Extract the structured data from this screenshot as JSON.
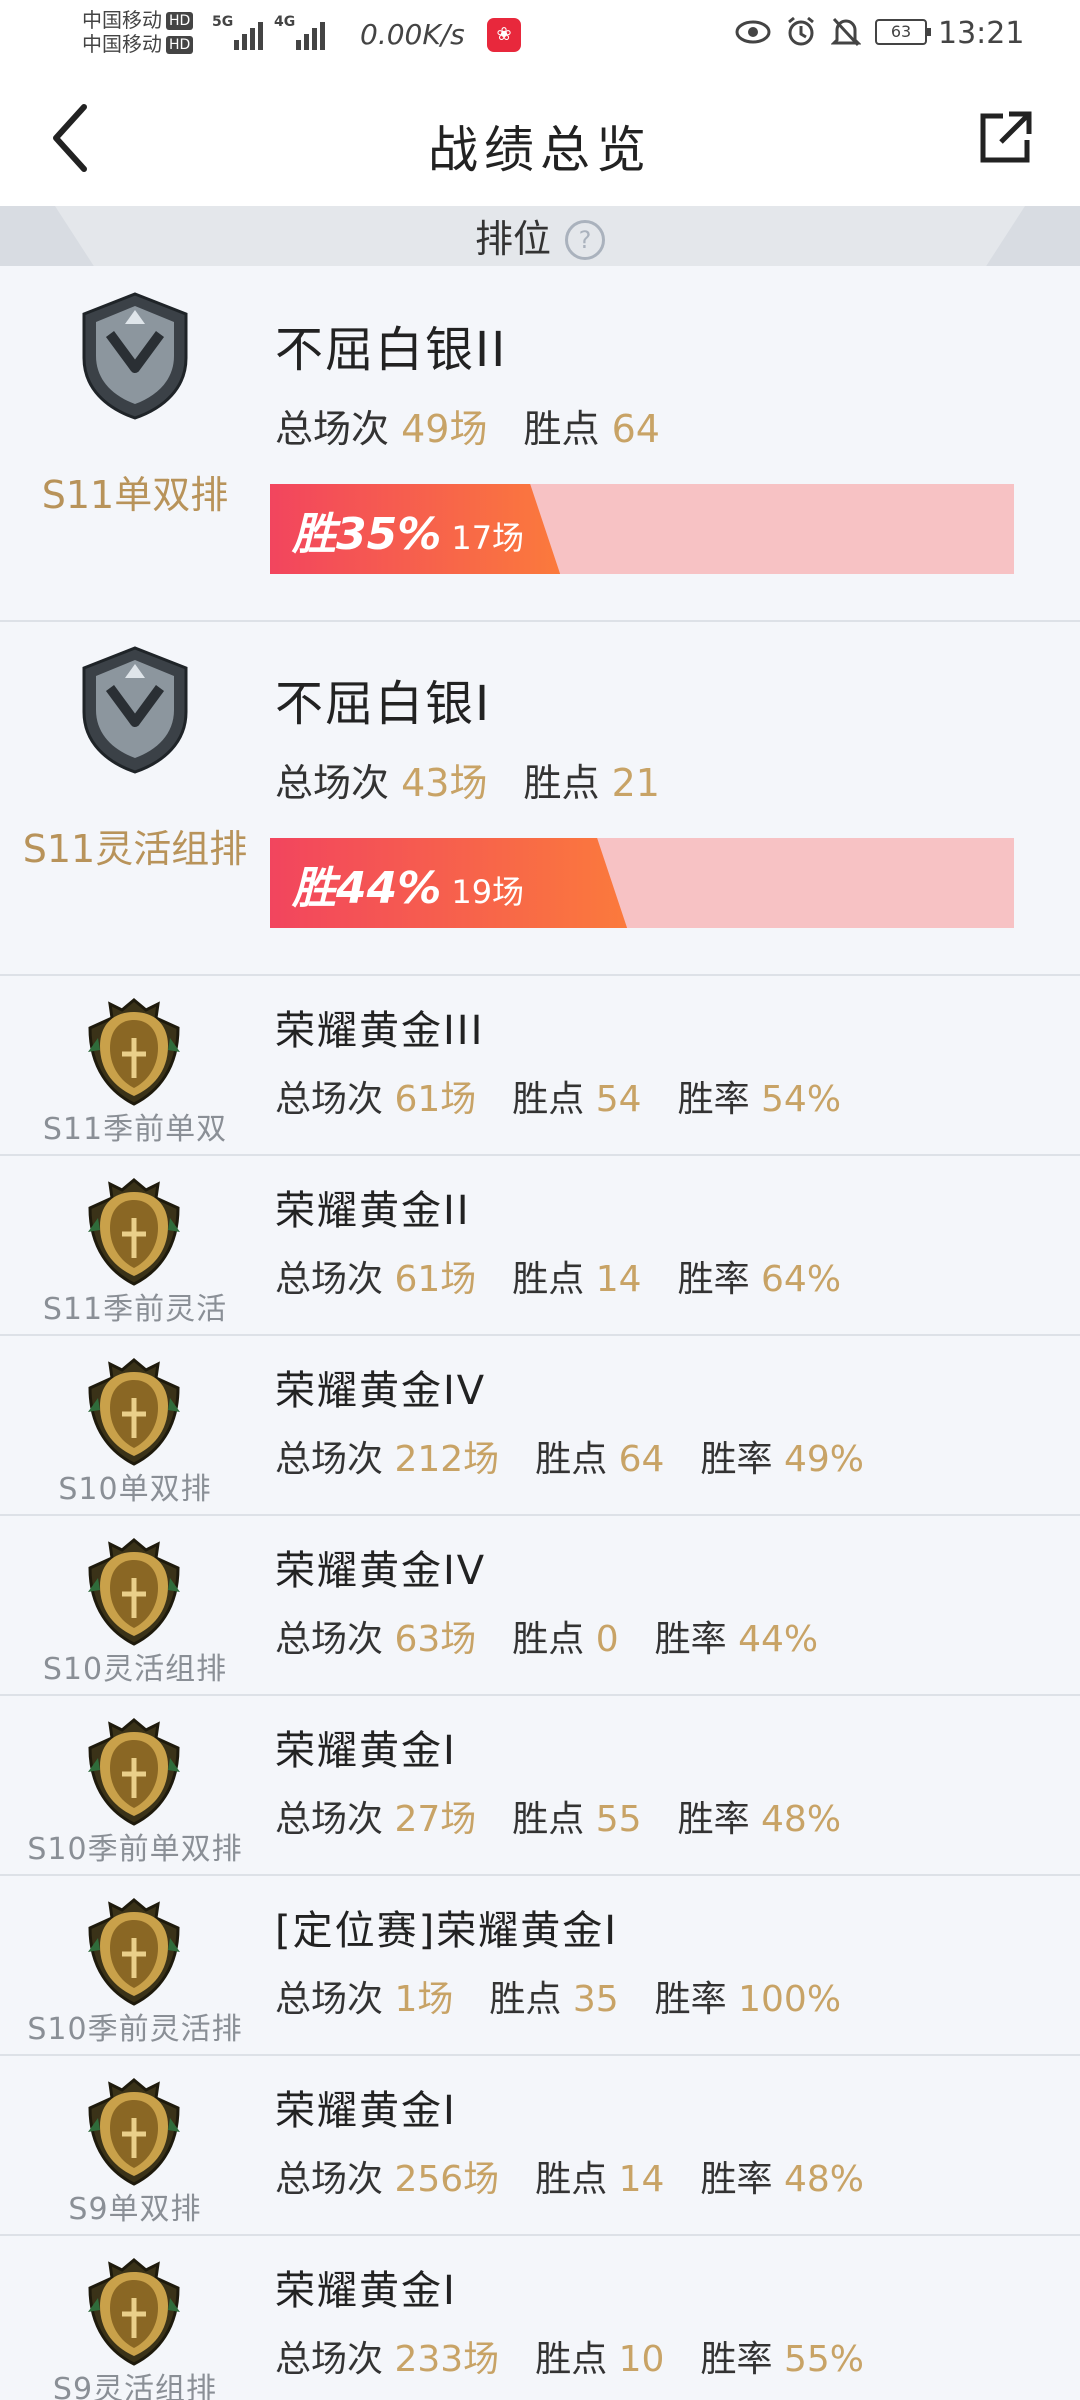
{
  "status_bar": {
    "carrier1": "中国移动",
    "carrier2": "中国移动",
    "hd": "HD",
    "sig1_label": "5G",
    "sig2_label": "4G",
    "net_speed": "0.00K/s",
    "battery": "63",
    "time": "13:21"
  },
  "header": {
    "title": "战绩总览"
  },
  "section": {
    "label": "排位",
    "help": "?"
  },
  "labels": {
    "total": "总场次",
    "points": "胜点",
    "rate": "胜率"
  },
  "colors": {
    "accent_gold": "#c8a366",
    "bar_fill": "#f2455e",
    "bar_track": "#f7c2c4"
  },
  "featured": [
    {
      "mode": "S11单双排",
      "rank": "不屈白银II",
      "emblem": "silver-emblem-icon",
      "total": "49场",
      "points": "64",
      "win_label": "胜35%",
      "win_fraction": 0.35,
      "win_count": "17场"
    },
    {
      "mode": "S11灵活组排",
      "rank": "不屈白银I",
      "emblem": "silver-emblem-icon",
      "total": "43场",
      "points": "21",
      "win_label": "胜44%",
      "win_fraction": 0.44,
      "win_count": "19场"
    }
  ],
  "history": [
    {
      "mode": "S11季前单双",
      "rank": "荣耀黄金III",
      "emblem": "gold-emblem-icon",
      "total": "61场",
      "points": "54",
      "rate": "54%"
    },
    {
      "mode": "S11季前灵活",
      "rank": "荣耀黄金II",
      "emblem": "gold-emblem-icon",
      "total": "61场",
      "points": "14",
      "rate": "64%"
    },
    {
      "mode": "S10单双排",
      "rank": "荣耀黄金IV",
      "emblem": "gold-emblem-icon",
      "total": "212场",
      "points": "64",
      "rate": "49%"
    },
    {
      "mode": "S10灵活组排",
      "rank": "荣耀黄金IV",
      "emblem": "gold-emblem-icon",
      "total": "63场",
      "points": "0",
      "rate": "44%"
    },
    {
      "mode": "S10季前单双排",
      "rank": "荣耀黄金I",
      "emblem": "gold-emblem-icon",
      "total": "27场",
      "points": "55",
      "rate": "48%"
    },
    {
      "mode": "S10季前灵活排",
      "rank": "[定位赛]荣耀黄金I",
      "emblem": "gold-emblem-icon",
      "total": "1场",
      "points": "35",
      "rate": "100%"
    },
    {
      "mode": "S9单双排",
      "rank": "荣耀黄金I",
      "emblem": "gold-emblem-icon",
      "total": "256场",
      "points": "14",
      "rate": "48%"
    },
    {
      "mode": "S9灵活组排",
      "rank": "荣耀黄金I",
      "emblem": "gold-emblem-icon",
      "total": "233场",
      "points": "10",
      "rate": "55%"
    }
  ]
}
